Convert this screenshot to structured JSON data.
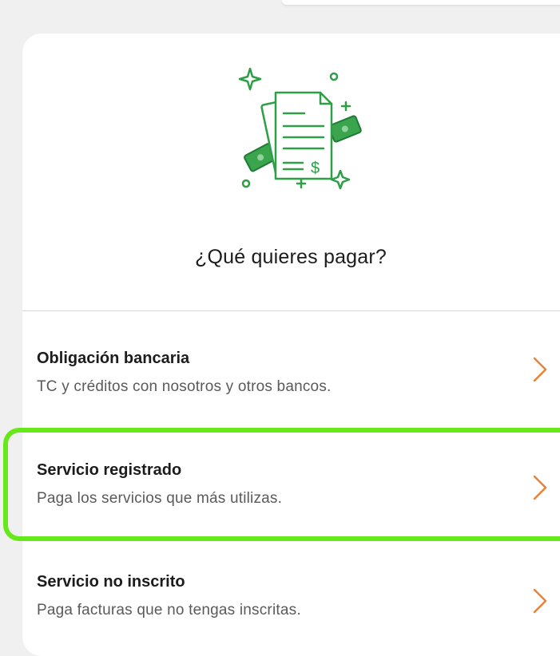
{
  "header": {
    "question": "¿Qué quieres pagar?"
  },
  "illustration": {
    "icon": "invoice-dollar-icon",
    "accent_color": "#2e9e47"
  },
  "options": [
    {
      "title": "Obligación bancaria",
      "description": "TC y créditos con nosotros y otros bancos."
    },
    {
      "title": "Servicio registrado",
      "description": "Paga los servicios que más utilizas."
    },
    {
      "title": "Servicio no inscrito",
      "description": "Paga facturas que no tengas inscritas."
    }
  ],
  "colors": {
    "chevron": "#e8833a",
    "highlight": "#66e81a",
    "text_primary": "#1c1c1c",
    "text_secondary": "#5a5a5a"
  }
}
